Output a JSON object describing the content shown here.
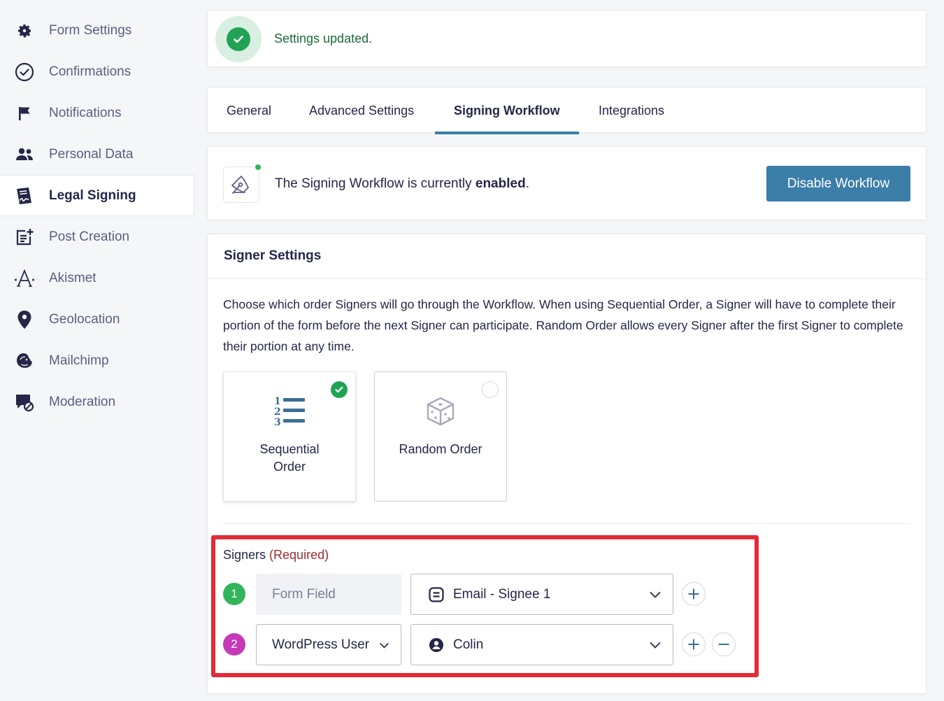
{
  "sidebar": {
    "items": [
      {
        "label": "Form Settings",
        "icon": "gear-icon"
      },
      {
        "label": "Confirmations",
        "icon": "check-circle-icon"
      },
      {
        "label": "Notifications",
        "icon": "flag-icon"
      },
      {
        "label": "Personal Data",
        "icon": "users-icon"
      },
      {
        "label": "Legal Signing",
        "icon": "signed-document-icon",
        "active": true
      },
      {
        "label": "Post Creation",
        "icon": "post-add-icon"
      },
      {
        "label": "Akismet",
        "icon": "akismet-icon"
      },
      {
        "label": "Geolocation",
        "icon": "map-pin-icon"
      },
      {
        "label": "Mailchimp",
        "icon": "mailchimp-icon"
      },
      {
        "label": "Moderation",
        "icon": "moderation-icon"
      }
    ]
  },
  "notice": {
    "message": "Settings updated.",
    "color": "#21a356"
  },
  "tabs": [
    {
      "label": "General"
    },
    {
      "label": "Advanced Settings"
    },
    {
      "label": "Signing Workflow",
      "active": true
    },
    {
      "label": "Integrations"
    }
  ],
  "workflow": {
    "text_prefix": "The Signing Workflow is currently ",
    "status": "enabled",
    "text_suffix": ".",
    "button_label": "Disable Workflow",
    "accent": "#3b7ea8"
  },
  "signer_settings": {
    "title": "Signer Settings",
    "description": "Choose which order Signers will go through the Workflow. When using Sequential Order, a Signer will have to complete their portion of the form before the next Signer can participate. Random Order allows every Signer after the first Signer to complete their portion at any time.",
    "orders": [
      {
        "label_line1": "Sequential",
        "label_line2": "Order",
        "selected": true
      },
      {
        "label": "Random Order",
        "selected": false
      }
    ],
    "signers_label": "Signers",
    "required_label": "(Required)",
    "signers": [
      {
        "number": "1",
        "type": "Form Field",
        "value": "Email - Signee 1",
        "value_icon": "field-icon"
      },
      {
        "number": "2",
        "type": "WordPress User",
        "value": "Colin",
        "value_icon": "user-icon"
      }
    ]
  }
}
